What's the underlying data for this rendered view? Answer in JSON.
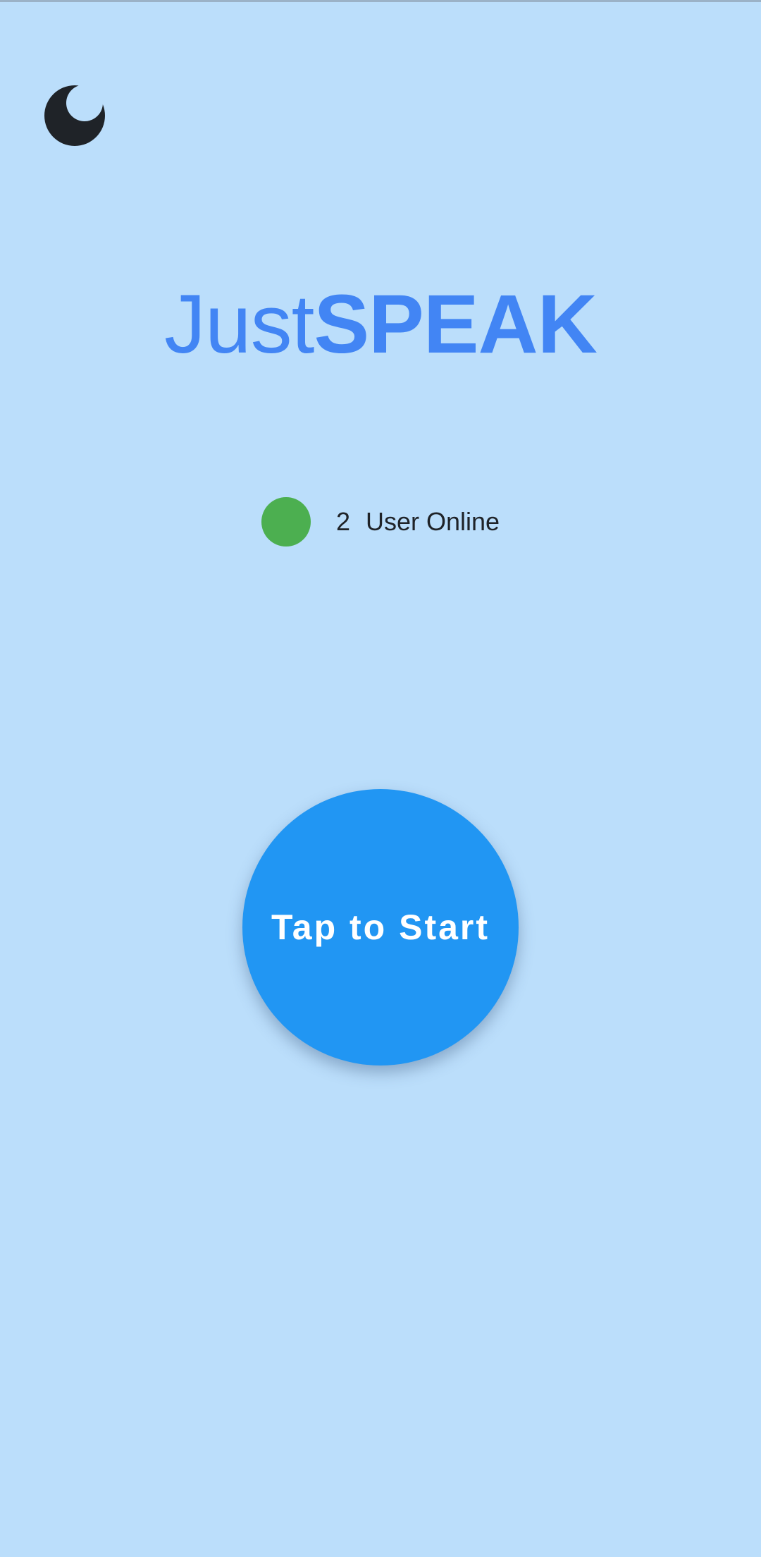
{
  "colors": {
    "background": "#BBDEFB",
    "title": "#4285F4",
    "online_indicator": "#4CAF50",
    "start_button": "#2196F3",
    "start_button_text": "#FFFFFF",
    "icon": "#1F2328"
  },
  "header": {
    "theme_toggle_icon": "moon-icon"
  },
  "title": {
    "part1": "Just",
    "part2": "SPEAK"
  },
  "status": {
    "count": "2",
    "label": "User Online"
  },
  "start_button": {
    "label": "Tap to Start"
  }
}
